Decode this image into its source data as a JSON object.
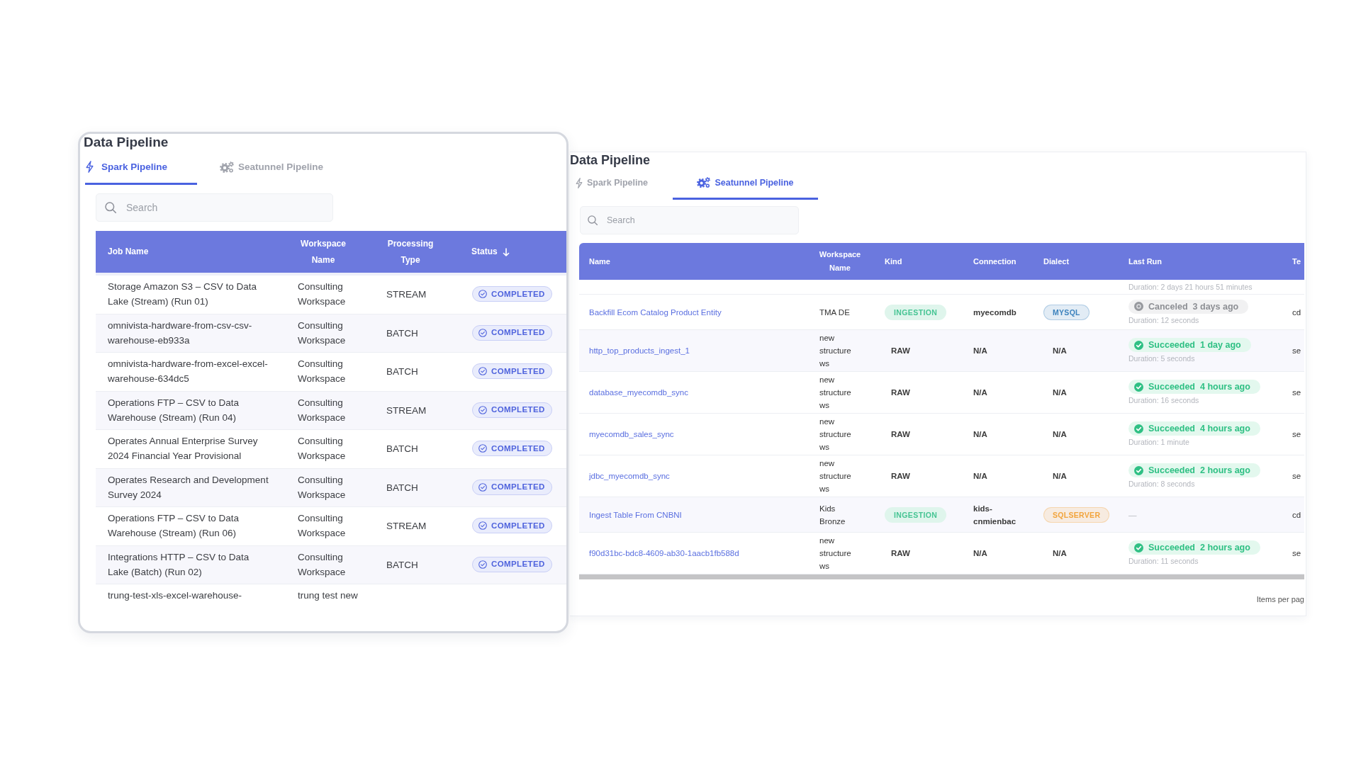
{
  "spark_view": {
    "title": "Data Pipeline",
    "tabs": [
      {
        "label": "Spark Pipeline",
        "selected": true
      },
      {
        "label": "Seatunnel Pipeline",
        "selected": false
      }
    ],
    "search": {
      "placeholder": "Search"
    },
    "table": {
      "columns": [
        {
          "label": "Job Name"
        },
        {
          "label": "Workspace Name"
        },
        {
          "label": "Processing Type"
        },
        {
          "label": "Status",
          "sorted_descending": true
        }
      ],
      "rows": [
        {
          "job_name": "Storage Amazon S3 – CSV to Data Lake (Stream) (Run 01)",
          "workspace_name": "Consulting Workspace",
          "processing_type": "STREAM",
          "status": {
            "kind": "completed",
            "text": "COMPLETED"
          }
        },
        {
          "job_name": "omnivista-hardware-from-csv-csv-warehouse-eb933a",
          "workspace_name": "Consulting Workspace",
          "processing_type": "BATCH",
          "status": {
            "kind": "completed",
            "text": "COMPLETED"
          }
        },
        {
          "job_name": "omnivista-hardware-from-excel-excel-warehouse-634dc5",
          "workspace_name": "Consulting Workspace",
          "processing_type": "BATCH",
          "status": {
            "kind": "completed",
            "text": "COMPLETED"
          }
        },
        {
          "job_name": "Operations FTP – CSV to Data Warehouse (Stream) (Run 04)",
          "workspace_name": "Consulting Workspace",
          "processing_type": "STREAM",
          "status": {
            "kind": "completed",
            "text": "COMPLETED"
          }
        },
        {
          "job_name": "Operates Annual Enterprise Survey 2024 Financial Year Provisional",
          "workspace_name": "Consulting Workspace",
          "processing_type": "BATCH",
          "status": {
            "kind": "completed",
            "text": "COMPLETED"
          }
        },
        {
          "job_name": "Operates Research and Development Survey 2024",
          "workspace_name": "Consulting Workspace",
          "processing_type": "BATCH",
          "status": {
            "kind": "completed",
            "text": "COMPLETED"
          }
        },
        {
          "job_name": "Operations FTP – CSV to Data Warehouse (Stream) (Run 06)",
          "workspace_name": "Consulting Workspace",
          "processing_type": "STREAM",
          "status": {
            "kind": "completed",
            "text": "COMPLETED"
          }
        },
        {
          "job_name": "Integrations HTTP – CSV to Data Lake (Batch) (Run 02)",
          "workspace_name": "Consulting Workspace",
          "processing_type": "BATCH",
          "status": {
            "kind": "completed",
            "text": "COMPLETED"
          }
        },
        {
          "job_name": "trung-test-xls-excel-warehouse-",
          "workspace_name": "trung test new"
        }
      ]
    }
  },
  "seatunnel_view": {
    "title": "Data Pipeline",
    "tabs": [
      {
        "label": "Spark Pipeline",
        "selected": false
      },
      {
        "label": "Seatunnel Pipeline",
        "selected": true
      }
    ],
    "search": {
      "placeholder": "Search"
    },
    "table": {
      "columns": [
        {
          "label": "Name"
        },
        {
          "label": "Workspace Name"
        },
        {
          "label": "Kind"
        },
        {
          "label": "Connection"
        },
        {
          "label": "Dialect"
        },
        {
          "label": "Last Run"
        },
        {
          "label": "Te"
        }
      ],
      "rows": [
        {
          "last_run": {
            "duration": "Duration: 2 days 21 hours 51 minutes"
          }
        },
        {
          "name": "Backfill Ecom Catalog Product Entity",
          "workspace_name": "TMA DE",
          "kind_tag": {
            "kind": "badge",
            "text": "INGESTION"
          },
          "connection": "myecomdb",
          "dialect": {
            "kind": "badge",
            "text": "MYSQL",
            "color": "#3c82bd"
          },
          "last_run": {
            "kind": "canceled",
            "label": "Canceled",
            "when": "3 days ago",
            "duration": "Duration: 12 seconds"
          },
          "column_7": "cd"
        },
        {
          "name": "http_top_products_ingest_1",
          "workspace_name": "new structure ws",
          "kind_tag": {
            "kind": "plain",
            "text": "RAW"
          },
          "connection": "N/A",
          "dialect": {
            "kind": "plain",
            "text": "N/A"
          },
          "last_run": {
            "kind": "succeeded",
            "label": "Succeeded",
            "when": "1 day ago",
            "duration": "Duration: 5 seconds"
          },
          "column_7": "se"
        },
        {
          "name": "database_myecomdb_sync",
          "workspace_name": "new structure ws",
          "kind_tag": {
            "kind": "plain",
            "text": "RAW"
          },
          "connection": "N/A",
          "dialect": {
            "kind": "plain",
            "text": "N/A"
          },
          "last_run": {
            "kind": "succeeded",
            "label": "Succeeded",
            "when": "4 hours ago",
            "duration": "Duration: 16 seconds"
          },
          "column_7": "se"
        },
        {
          "name": "myecomdb_sales_sync",
          "workspace_name": "new structure ws",
          "kind_tag": {
            "kind": "plain",
            "text": "RAW"
          },
          "connection": "N/A",
          "dialect": {
            "kind": "plain",
            "text": "N/A"
          },
          "last_run": {
            "kind": "succeeded",
            "label": "Succeeded",
            "when": "4 hours ago",
            "duration": "Duration: 1 minute"
          },
          "column_7": "se"
        },
        {
          "name": "jdbc_myecomdb_sync",
          "workspace_name": "new structure ws",
          "kind_tag": {
            "kind": "plain",
            "text": "RAW"
          },
          "connection": "N/A",
          "dialect": {
            "kind": "plain",
            "text": "N/A"
          },
          "last_run": {
            "kind": "succeeded",
            "label": "Succeeded",
            "when": "2 hours ago",
            "duration": "Duration: 8 seconds"
          },
          "column_7": "se"
        },
        {
          "name": "Ingest Table From CNBNI",
          "workspace_name": "Kids Bronze",
          "kind_tag": {
            "kind": "badge",
            "text": "INGESTION"
          },
          "connection": "kids-cnmienbac",
          "dialect": {
            "kind": "badge",
            "text": "SQLSERVER",
            "color": "#f2a43c"
          },
          "last_run": {
            "kind": "none",
            "text": "—"
          },
          "column_7": "cd"
        },
        {
          "name": "f90d31bc-bdc8-4609-ab30-1aacb1fb588d",
          "workspace_name": "new structure ws",
          "kind_tag": {
            "kind": "plain",
            "text": "RAW"
          },
          "connection": "N/A",
          "dialect": {
            "kind": "plain",
            "text": "N/A"
          },
          "last_run": {
            "kind": "succeeded",
            "label": "Succeeded",
            "when": "2 hours ago",
            "duration": "Duration: 11 seconds"
          },
          "column_7": "se"
        }
      ]
    },
    "pagination": {
      "label": "Items per pag"
    }
  }
}
